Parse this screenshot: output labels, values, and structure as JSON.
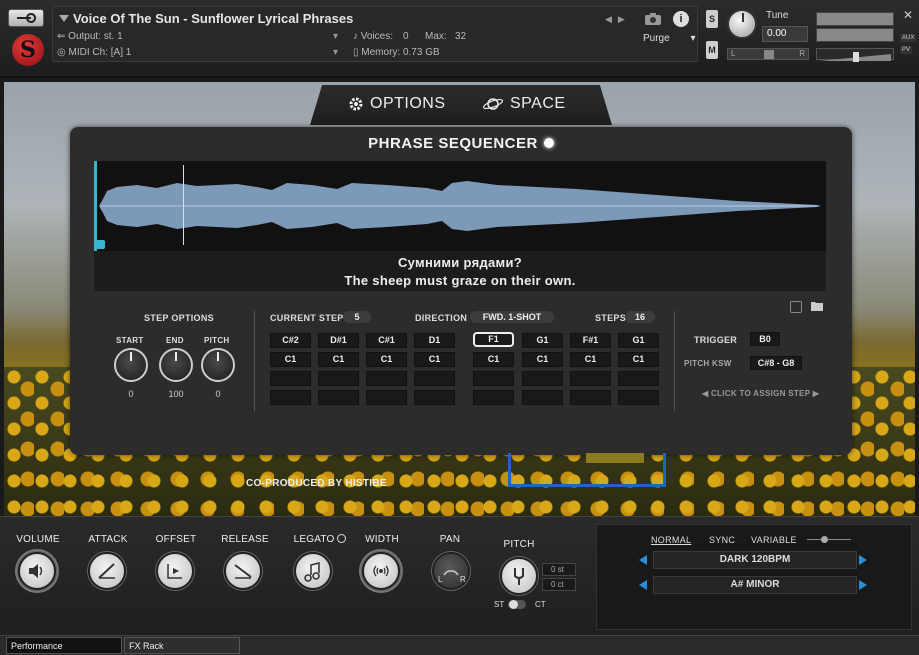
{
  "header": {
    "title": "Voice Of The Sun - Sunflower Lyrical Phrases",
    "output_label": "Output:",
    "output_value": "st. 1",
    "midi_label": "MIDI Ch:",
    "midi_value": "[A]  1",
    "voices_label": "Voices:",
    "voices_value": "0",
    "max_label": "Max:",
    "max_value": "32",
    "memory_label": "Memory:",
    "memory_value": "0.73 GB",
    "purge_label": "Purge",
    "tune_label": "Tune",
    "tune_value": "0.00",
    "s_label": "S",
    "m_label": "M",
    "aux_label": "AUX",
    "pv_label": "PV",
    "pan_left": "L",
    "pan_right": "R"
  },
  "tabs": {
    "options": "OPTIONS",
    "space": "SPACE"
  },
  "sequencer": {
    "title": "PHRASE SEQUENCER",
    "lyrics_line1": "Сумними рядами?",
    "lyrics_line2": "The sheep must graze on their own.",
    "step_options": "STEP OPTIONS",
    "start_label": "START",
    "end_label": "END",
    "pitch_label": "PITCH",
    "start_value": "0",
    "end_value": "100",
    "pitch_value": "0",
    "current_step_label": "CURRENT STEP",
    "current_step_value": "5",
    "direction_label": "DIRECTION",
    "direction_value": "FWD. 1-SHOT",
    "steps_label": "STEPS",
    "steps_value": "16",
    "grid_row1": [
      "C#2",
      "D#1",
      "C#1",
      "D1",
      "F1",
      "G1",
      "F#1",
      "G1"
    ],
    "grid_row2": [
      "C1",
      "C1",
      "C1",
      "C1",
      "C1",
      "C1",
      "C1",
      "C1"
    ],
    "trigger_label": "TRIGGER",
    "trigger_value": "B0",
    "pitch_ksw_label": "PITCH KSW",
    "pitch_ksw_value": "C#8 - G8",
    "click_assign": "CLICK TO ASSIGN STEP"
  },
  "coproduced": "CO-PRODUCED BY HISTIBE",
  "controls": {
    "volume": "VOLUME",
    "attack": "ATTACK",
    "offset": "OFFSET",
    "release": "RELEASE",
    "legato": "LEGATO",
    "width": "WIDTH",
    "pan": "PAN",
    "pitch": "PITCH",
    "pan_l": "L",
    "pan_r": "R",
    "st_label": "ST",
    "ct_label": "CT",
    "st_value": "0 st",
    "ct_value": "0 ct"
  },
  "tempo": {
    "normal": "NORMAL",
    "sync": "SYNC",
    "variable": "VARIABLE",
    "preset": "DARK 120BPM",
    "key": "A# MINOR"
  },
  "footer": {
    "performance": "Performance",
    "fx_rack": "FX Rack"
  },
  "colors": {
    "accent_blue": "#2a8ed8",
    "waveform": "#a8c8e8",
    "logo_red": "#c82020"
  }
}
